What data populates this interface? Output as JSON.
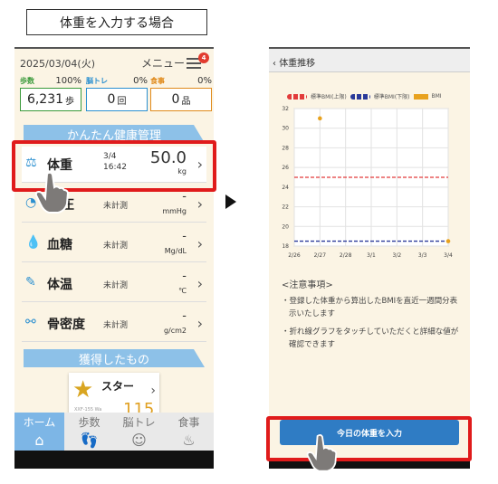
{
  "caption": "体重を入力する場合",
  "left": {
    "date": "2025/03/04(火)",
    "menu_label": "メニュー",
    "badge_count": "4",
    "stats": [
      {
        "label": "歩数",
        "pct": "100%",
        "value": "6,231",
        "unit": "歩"
      },
      {
        "label": "脳トレ",
        "pct": "0%",
        "value": "0",
        "unit": "回"
      },
      {
        "label": "食事",
        "pct": "0%",
        "value": "0",
        "unit": "品"
      }
    ],
    "section_health": "かんたん健康管理",
    "rows": [
      {
        "name": "体重",
        "date": "3/4",
        "time": "16:42",
        "value": "50.0",
        "unit": "kg"
      },
      {
        "name": "圧",
        "status": "未計測",
        "value": "-",
        "unit": "mmHg"
      },
      {
        "name": "血糖",
        "status": "未計測",
        "value": "-",
        "unit": "Mg/dL"
      },
      {
        "name": "体温",
        "status": "未計測",
        "value": "-",
        "unit": "℃"
      },
      {
        "name": "骨密度",
        "status": "未計測",
        "value": "-",
        "unit": "g/cm2"
      }
    ],
    "section_rewards": "獲得したもの",
    "reward": {
      "name": "スター",
      "sub": "XXF-155 Wa",
      "count": "115"
    },
    "tabs": [
      "ホーム",
      "歩数",
      "脳トレ",
      "食事"
    ]
  },
  "right": {
    "title": "体重推移",
    "legend": [
      "標準BMI(上限)",
      "標準BMI(下限)",
      "BMI"
    ],
    "notes_title": "<注意事項>",
    "notes": [
      "・登録した体重から算出したBMIを直近一週間分表示いたします",
      "・折れ線グラフをタッチしていただくと詳細な値が確認できます"
    ],
    "cta": "今日の体重を入力"
  },
  "colors": {
    "upper": "#e23b3b",
    "lower": "#2a3a9a",
    "bmi": "#e8a21e",
    "red_frame": "#e01b1b"
  },
  "chart_data": {
    "type": "line",
    "x": [
      "2/26",
      "2/27",
      "2/28",
      "3/1",
      "3/2",
      "3/3",
      "3/4"
    ],
    "yticks": [
      18,
      20,
      22,
      24,
      26,
      28,
      30,
      32
    ],
    "ylim": [
      18,
      32
    ],
    "series": [
      {
        "name": "標準BMI(上限)",
        "values": [
          25,
          25,
          25,
          25,
          25,
          25,
          25
        ]
      },
      {
        "name": "標準BMI(下限)",
        "values": [
          18.5,
          18.5,
          18.5,
          18.5,
          18.5,
          18.5,
          18.5
        ]
      },
      {
        "name": "BMI",
        "points": [
          [
            "2/27",
            31
          ],
          [
            "3/4",
            18.5
          ]
        ]
      }
    ]
  }
}
